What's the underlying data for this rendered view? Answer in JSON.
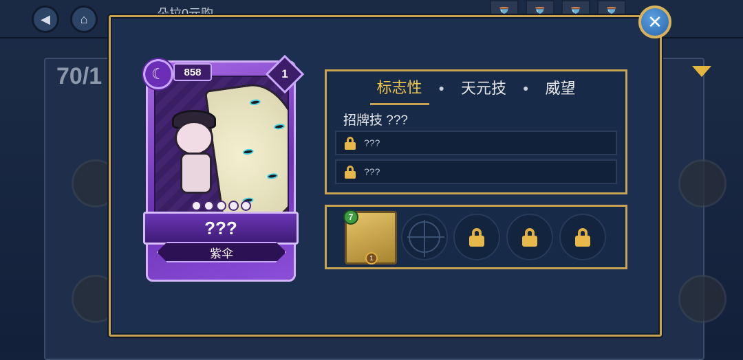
{
  "background": {
    "title": "朵拉0元购",
    "count": "70/1",
    "back_icon": "back-arrow-icon",
    "home_icon": "home-icon",
    "filter_icon": "filter-icon"
  },
  "top_bar": {
    "timers": [
      "hourglass-icon",
      "hourglass-icon",
      "hourglass-icon",
      "hourglass-icon"
    ],
    "close_icon": "close-icon"
  },
  "card": {
    "power": "858",
    "level": "1",
    "element_icon": "moon-icon",
    "name": "???",
    "subname": "紫伞",
    "skull_count": 5
  },
  "tabs": {
    "items": [
      "标志性",
      "天元技",
      "威望"
    ],
    "active_index": 0
  },
  "skills": {
    "title": "招牌技 ???",
    "slots": [
      "???",
      "???"
    ]
  },
  "equipment": {
    "level": "7",
    "badge": "1",
    "empty_slot_icon": "target-icon",
    "locked_slots": 3
  },
  "colors": {
    "gold_border": "#c8a353",
    "active_tab": "#efc64d",
    "card_purple": "#6d32b6"
  }
}
